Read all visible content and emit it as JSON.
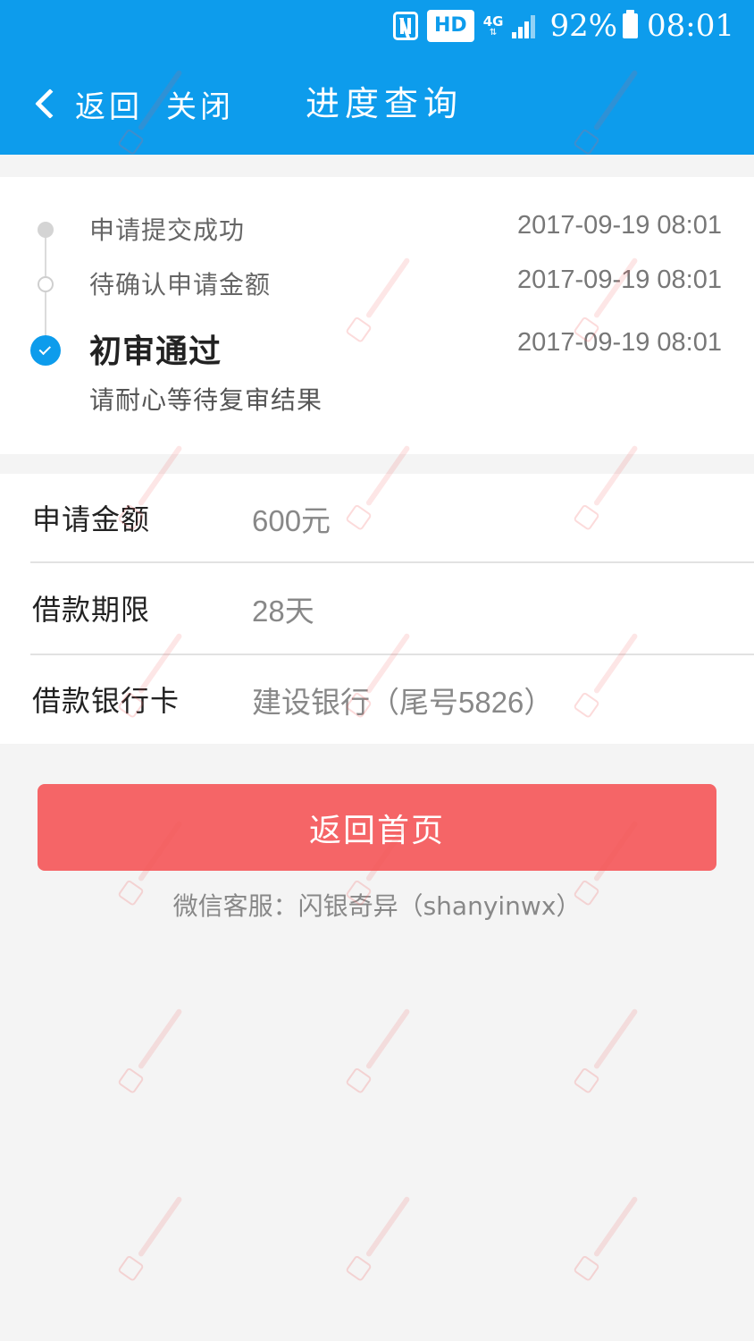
{
  "status_bar": {
    "hd_label": "HD",
    "network_label": "4G",
    "network_arrows": "⇅",
    "battery": "92%",
    "time": "08:01"
  },
  "nav": {
    "back_label": "返回",
    "close_label": "关闭",
    "title": "进度查询"
  },
  "timeline": {
    "steps": [
      {
        "label": "申请提交成功",
        "time": "2017-09-19 08:01"
      },
      {
        "label": "待确认申请金额",
        "time": "2017-09-19 08:01"
      },
      {
        "label": "初审通过",
        "time": "2017-09-19 08:01",
        "sub": "请耐心等待复审结果"
      }
    ]
  },
  "info": {
    "rows": [
      {
        "label": "申请金额",
        "value": "600元"
      },
      {
        "label": "借款期限",
        "value": "28天"
      },
      {
        "label": "借款银行卡",
        "value": "建设银行（尾号5826）"
      }
    ]
  },
  "actions": {
    "home_button": "返回首页",
    "service_text": "微信客服：闪银奇异（shanyinwx）"
  },
  "colors": {
    "header": "#0d9cec",
    "button": "#f56567",
    "background": "#f4f4f4"
  },
  "icons": {
    "back": "chevron-left-icon",
    "nfc": "nfc-icon",
    "signal": "signal-icon",
    "battery": "battery-icon",
    "check": "check-icon"
  }
}
